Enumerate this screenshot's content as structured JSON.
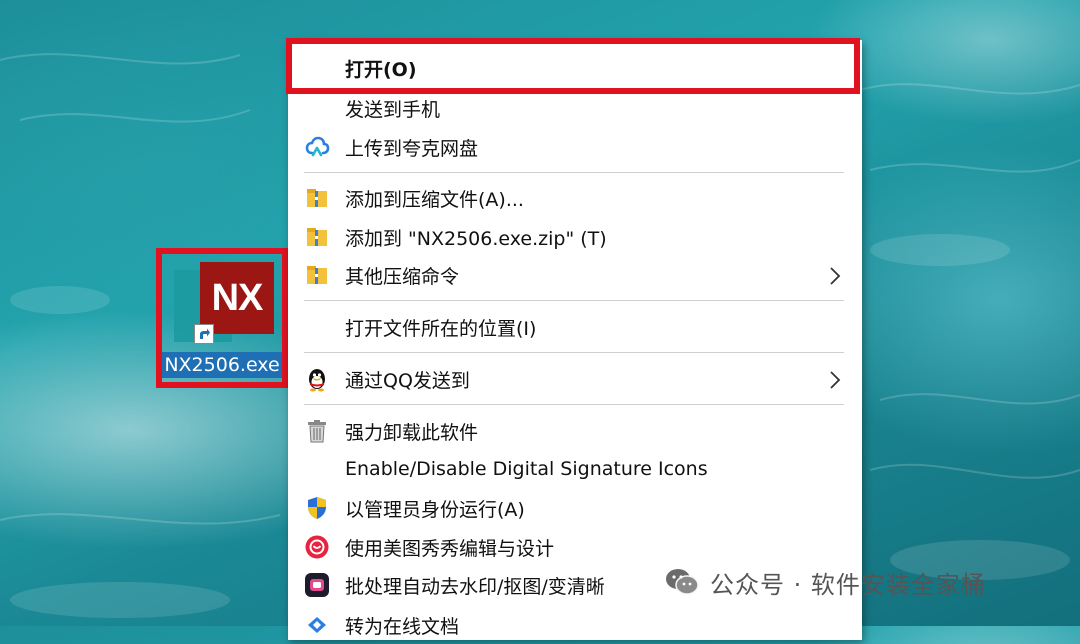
{
  "desktop_icon": {
    "logo_text": "NX",
    "label": "NX2506.exe",
    "icon_name": "nx-app-shortcut-icon"
  },
  "context_menu": {
    "items": [
      {
        "label": "打开(O)",
        "icon": null,
        "submenu": false
      },
      {
        "label": "发送到手机",
        "icon": null,
        "submenu": false
      },
      {
        "label": "上传到夸克网盘",
        "icon": "quark-cloud-icon",
        "submenu": false
      },
      {
        "label": "添加到压缩文件(A)...",
        "icon": "archive-icon",
        "submenu": false
      },
      {
        "label": "添加到 \"NX2506.exe.zip\" (T)",
        "icon": "archive-icon",
        "submenu": false
      },
      {
        "label": "其他压缩命令",
        "icon": "archive-icon",
        "submenu": true
      },
      {
        "label": "打开文件所在的位置(I)",
        "icon": null,
        "submenu": false
      },
      {
        "label": "通过QQ发送到",
        "icon": "qq-penguin-icon",
        "submenu": true
      },
      {
        "label": "强力卸载此软件",
        "icon": "trash-icon",
        "submenu": false
      },
      {
        "label": "Enable/Disable Digital Signature Icons",
        "icon": null,
        "submenu": false
      },
      {
        "label": "以管理员身份运行(A)",
        "icon": "uac-shield-icon",
        "submenu": false
      },
      {
        "label": "使用美图秀秀编辑与设计",
        "icon": "meitu-icon",
        "submenu": false
      },
      {
        "label": "批处理自动去水印/抠图/变清晰",
        "icon": "batch-edit-icon",
        "submenu": false
      },
      {
        "label": "转为在线文档",
        "icon": "online-doc-icon",
        "submenu": false
      }
    ]
  },
  "watermark": {
    "text": "公众号 · 软件安装全家桶",
    "icon": "wechat-icon"
  },
  "colors": {
    "highlight_border": "#e0121f",
    "nx_red": "#9c1614",
    "label_selection": "#1f6fb5"
  }
}
